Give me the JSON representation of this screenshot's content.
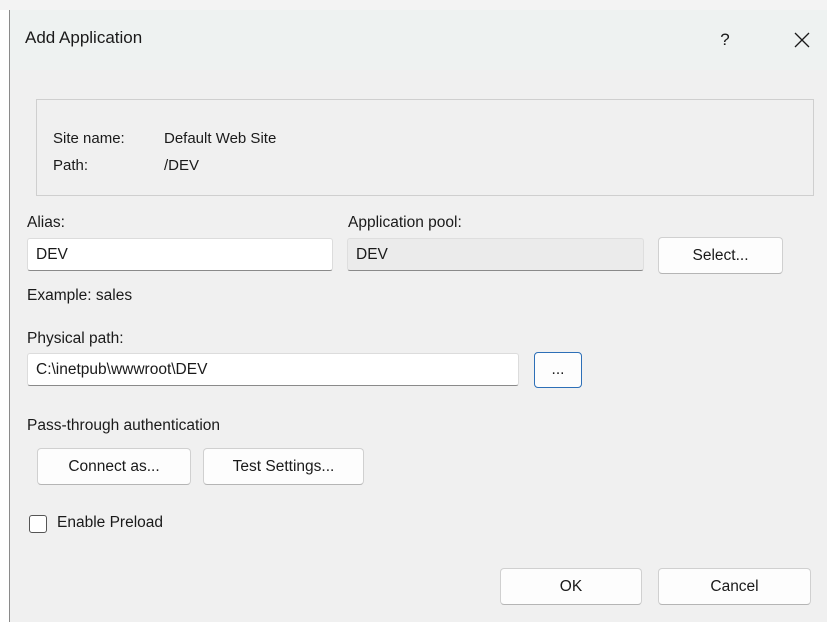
{
  "window": {
    "title": "Add Application",
    "help_label": "?",
    "close_icon": "close-icon"
  },
  "info": {
    "site_name_label": "Site name:",
    "site_name_value": "Default Web Site",
    "path_label": "Path:",
    "path_value": "/DEV"
  },
  "alias": {
    "label": "Alias:",
    "value": "DEV",
    "example": "Example: sales"
  },
  "app_pool": {
    "label": "Application pool:",
    "value": "DEV",
    "select_button": "Select..."
  },
  "physical_path": {
    "label": "Physical path:",
    "value": "C:\\inetpub\\wwwroot\\DEV",
    "browse_button": "..."
  },
  "auth": {
    "label": "Pass-through authentication",
    "connect_as_button": "Connect as...",
    "test_settings_button": "Test Settings..."
  },
  "preload": {
    "label": "Enable Preload",
    "checked": false
  },
  "footer": {
    "ok_button": "OK",
    "cancel_button": "Cancel"
  },
  "colors": {
    "dialog_bg": "#f0f0f0",
    "titlebar_bg": "#eef2f1",
    "focus_border": "#2d6fb7"
  }
}
